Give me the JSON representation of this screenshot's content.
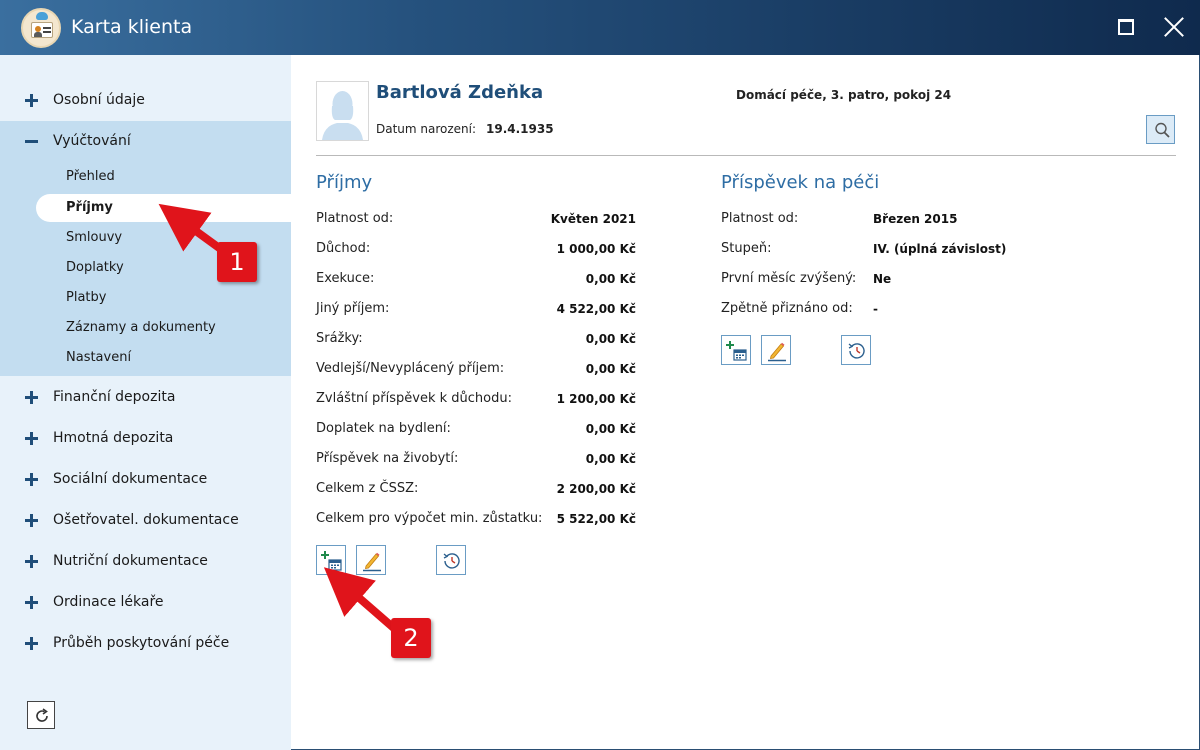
{
  "window": {
    "title": "Karta klienta"
  },
  "sidebar": {
    "items": [
      {
        "label": "Osobní údaje",
        "expanded": false
      },
      {
        "label": "Vyúčtování",
        "expanded": true
      },
      {
        "label": "Finanční depozita",
        "expanded": false
      },
      {
        "label": "Hmotná depozita",
        "expanded": false
      },
      {
        "label": "Sociální dokumentace",
        "expanded": false
      },
      {
        "label": "Ošetřovatel. dokumentace",
        "expanded": false
      },
      {
        "label": "Nutriční dokumentace",
        "expanded": false
      },
      {
        "label": "Ordinace lékaře",
        "expanded": false
      },
      {
        "label": "Průběh poskytování péče",
        "expanded": false
      }
    ],
    "subitems": [
      {
        "label": "Přehled",
        "active": false
      },
      {
        "label": "Příjmy",
        "active": true
      },
      {
        "label": "Smlouvy",
        "active": false
      },
      {
        "label": "Doplatky",
        "active": false
      },
      {
        "label": "Platby",
        "active": false
      },
      {
        "label": "Záznamy a dokumenty",
        "active": false
      },
      {
        "label": "Nastavení",
        "active": false
      }
    ]
  },
  "client": {
    "name": "Bartlová Zdeňka",
    "dob_label": "Datum narození:",
    "dob": "19.4.1935",
    "location": "Domácí péče, 3. patro, pokoj 24"
  },
  "income": {
    "title": "Příjmy",
    "rows": [
      {
        "label": "Platnost od:",
        "value": "Květen 2021"
      },
      {
        "label": "Důchod:",
        "value": "1 000,00 Kč"
      },
      {
        "label": "Exekuce:",
        "value": "0,00 Kč"
      },
      {
        "label": "Jiný příjem:",
        "value": "4 522,00 Kč"
      },
      {
        "label": "Srážky:",
        "value": "0,00 Kč"
      },
      {
        "label": "Vedlejší/Nevyplácený příjem:",
        "value": "0,00 Kč"
      },
      {
        "label": "Zvláštní příspěvek k důchodu:",
        "value": "1 200,00 Kč"
      },
      {
        "label": "Doplatek na bydlení:",
        "value": "0,00 Kč"
      },
      {
        "label": "Příspěvek na živobytí:",
        "value": "0,00 Kč"
      },
      {
        "label": "Celkem z ČSSZ:",
        "value": "2 200,00 Kč"
      },
      {
        "label": "Celkem pro výpočet min. zůstatku:",
        "value": "5 522,00 Kč"
      }
    ]
  },
  "care": {
    "title": "Příspěvek na péči",
    "rows": [
      {
        "label": "Platnost od:",
        "value": "Březen 2015"
      },
      {
        "label": "Stupeň:",
        "value": "IV. (úplná závislost)"
      },
      {
        "label": "První měsíc zvýšený:",
        "value": "Ne"
      },
      {
        "label": "Zpětně přiznáno od:",
        "value": "-"
      }
    ]
  },
  "icons": {
    "add": "add-calendar-icon",
    "edit": "pencil-icon",
    "history": "history-icon",
    "search": "search-icon",
    "refresh": "refresh-icon"
  },
  "annotations": {
    "callout_1": "1",
    "callout_2": "2"
  },
  "colors": {
    "accent": "#1f4e79",
    "sidebar_bg": "#e8f2fa",
    "sidebar_open": "#c3ddf0",
    "callout": "#e0141b"
  }
}
